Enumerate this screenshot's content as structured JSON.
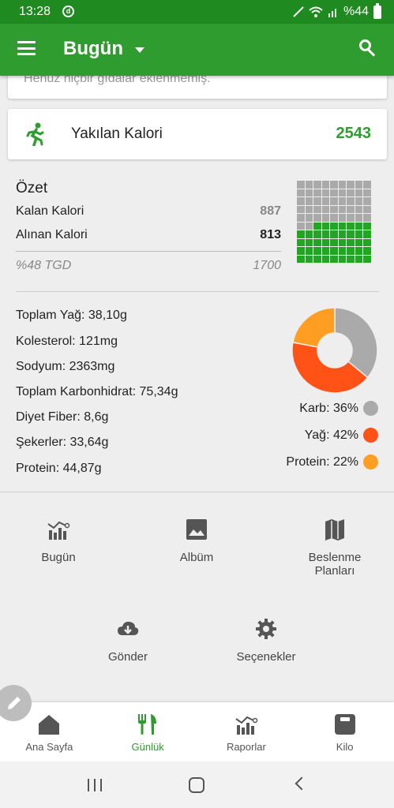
{
  "status_bar": {
    "time": "13:28",
    "battery": "%44"
  },
  "app_bar": {
    "title": "Bugün"
  },
  "empty_notice": "Henüz hiçbir gıdalar eklenmemiş.",
  "burned": {
    "label": "Yakılan Kalori",
    "value": "2543"
  },
  "summary": {
    "title": "Özet",
    "remaining_label": "Kalan Kalori",
    "remaining_value": "887",
    "taken_label": "Alınan Kalori",
    "taken_value": "813",
    "tgd_label": "%48 TGD",
    "tgd_value": "1700",
    "grid_fill_percent": 48
  },
  "nutrients": [
    "Toplam Yağ: 38,10g",
    "Kolesterol: 121mg",
    "Sodyum: 2363mg",
    "Toplam Karbonhidrat: 75,34g",
    "Diyet Fiber: 8,6g",
    "Şekerler: 33,64g",
    "Protein: 44,87g"
  ],
  "macros": [
    {
      "label": "Karb: 36%",
      "percent": 36,
      "color": "#aaaaaa"
    },
    {
      "label": "Yağ: 42%",
      "percent": 42,
      "color": "#ff5216"
    },
    {
      "label": "Protein: 22%",
      "percent": 22,
      "color": "#ff9e22"
    }
  ],
  "shortcuts": {
    "today": "Bugün",
    "album": "Albüm",
    "diet_plans_1": "Beslenme",
    "diet_plans_2": "Planları",
    "send": "Gönder",
    "options": "Seçenekler"
  },
  "bottom_nav": {
    "home": "Ana Sayfa",
    "diary": "Günlük",
    "reports": "Raporlar",
    "weight": "Kilo"
  },
  "colors": {
    "brand": "#2e9c2e",
    "status_bar": "#1f8a1f"
  }
}
